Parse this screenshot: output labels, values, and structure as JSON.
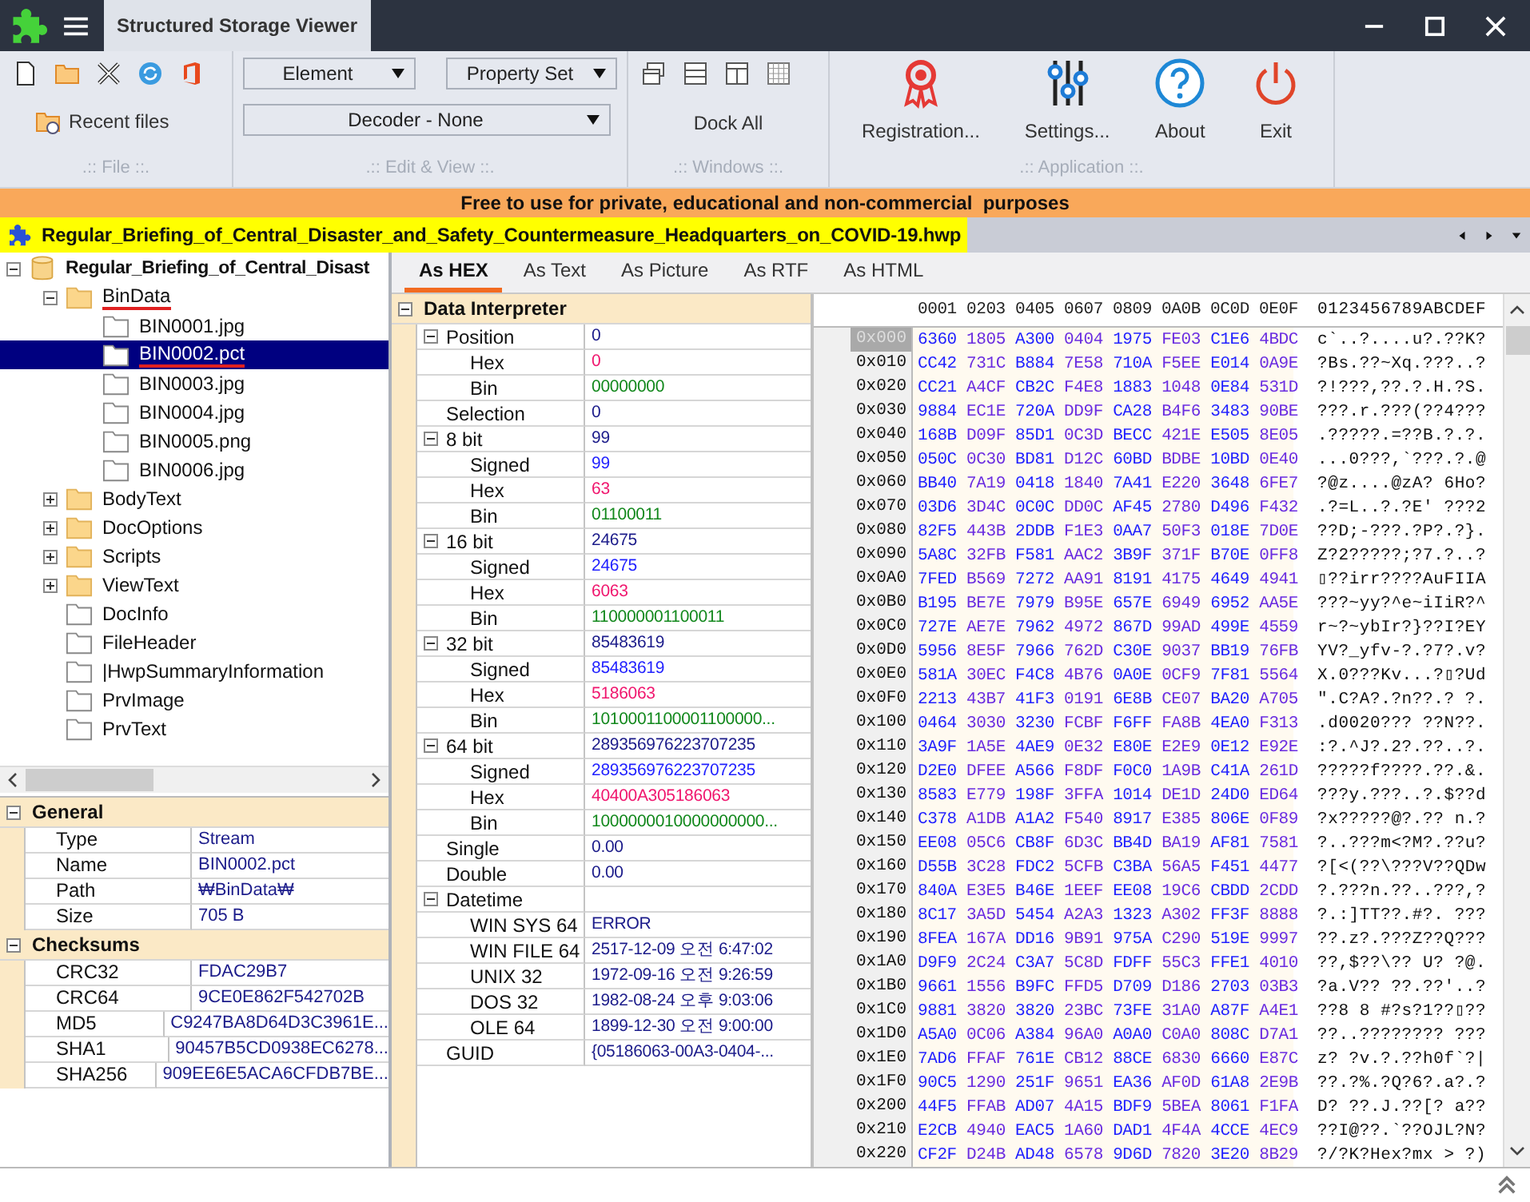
{
  "window": {
    "title": "Structured Storage Viewer"
  },
  "ribbon": {
    "file": {
      "recent": "Recent files",
      "label": ".:: File ::."
    },
    "edit": {
      "dropdowns": [
        "Element",
        "Property Set"
      ],
      "decoder": "Decoder - None",
      "label": ".:: Edit & View ::."
    },
    "windows": {
      "dock": "Dock All",
      "label": ".:: Windows ::."
    },
    "application": {
      "buttons": [
        {
          "kind": "registration",
          "label": "Registration..."
        },
        {
          "kind": "settings",
          "label": "Settings..."
        },
        {
          "kind": "about",
          "label": "About"
        },
        {
          "kind": "exit",
          "label": "Exit"
        }
      ],
      "label": ".:: Application ::."
    }
  },
  "banner": "Free to use for private, educational and non-commercial  purposes",
  "document_tab": {
    "title": "Regular_Briefing_of_Central_Disaster_and_Safety_Countermeasure_Headquarters_on_COVID-19.hwp"
  },
  "tree": {
    "items": [
      {
        "label": "Regular_Briefing_of_Central_Disast",
        "kind": "storage",
        "expanded": true,
        "selected": false,
        "children": [
          {
            "label": "BinData",
            "kind": "folder",
            "expanded": true,
            "selected": false,
            "underlined": true,
            "children": [
              {
                "label": "BIN0001.jpg",
                "kind": "file",
                "selected": false
              },
              {
                "label": "BIN0002.pct",
                "kind": "file",
                "selected": true,
                "underlined": true
              },
              {
                "label": "BIN0003.jpg",
                "kind": "file",
                "selected": false
              },
              {
                "label": "BIN0004.jpg",
                "kind": "file",
                "selected": false
              },
              {
                "label": "BIN0005.png",
                "kind": "file",
                "selected": false
              },
              {
                "label": "BIN0006.jpg",
                "kind": "file",
                "selected": false
              }
            ]
          },
          {
            "label": "BodyText",
            "kind": "folder",
            "expanded": false,
            "selected": false
          },
          {
            "label": "DocOptions",
            "kind": "folder",
            "expanded": false,
            "selected": false
          },
          {
            "label": "Scripts",
            "kind": "folder",
            "expanded": false,
            "selected": false
          },
          {
            "label": "ViewText",
            "kind": "folder",
            "expanded": false,
            "selected": false
          },
          {
            "label": "DocInfo",
            "kind": "file",
            "selected": false
          },
          {
            "label": "FileHeader",
            "kind": "file",
            "selected": false
          },
          {
            "label": "|HwpSummaryInformation",
            "kind": "file",
            "selected": false
          },
          {
            "label": "PrvImage",
            "kind": "file",
            "selected": false
          },
          {
            "label": "PrvText",
            "kind": "file",
            "selected": false
          }
        ]
      }
    ]
  },
  "properties": [
    {
      "title": "General",
      "expanded": true,
      "rows": [
        {
          "name": "Type",
          "value": "Stream"
        },
        {
          "name": "Name",
          "value": "BIN0002.pct"
        },
        {
          "name": "Path",
          "value": "₩BinData₩"
        },
        {
          "name": "Size",
          "value": "705 B"
        }
      ]
    },
    {
      "title": "Checksums",
      "expanded": true,
      "rows": [
        {
          "name": "CRC32",
          "value": "FDAC29B7"
        },
        {
          "name": "CRC64",
          "value": "9CE0E862F542702B"
        },
        {
          "name": "MD5",
          "value": "C9247BA8D64D3C3961E..."
        },
        {
          "name": "SHA1",
          "value": "90457B5CD0938EC6278..."
        },
        {
          "name": "SHA256",
          "value": "909EE6E5ACA6CFDB7BE..."
        }
      ]
    }
  ],
  "view_tabs": [
    {
      "label": "As HEX",
      "selected": true
    },
    {
      "label": "As Text",
      "selected": false
    },
    {
      "label": "As Picture",
      "selected": false
    },
    {
      "label": "As RTF",
      "selected": false
    },
    {
      "label": "As HTML",
      "selected": false
    }
  ],
  "interpreter": {
    "title": "Data Interpreter",
    "expanded": true,
    "rows": [
      {
        "name": "Position",
        "value": "0",
        "kind": "number",
        "expanded": true,
        "children": [
          {
            "name": "Hex",
            "value": "0",
            "kind": "hex"
          },
          {
            "name": "Bin",
            "value": "00000000",
            "kind": "bin"
          }
        ]
      },
      {
        "name": "Selection",
        "value": "0",
        "kind": "number"
      },
      {
        "name": "8 bit",
        "value": "99",
        "kind": "number",
        "expanded": true,
        "children": [
          {
            "name": "Signed",
            "value": "99",
            "kind": "signed"
          },
          {
            "name": "Hex",
            "value": "63",
            "kind": "hex"
          },
          {
            "name": "Bin",
            "value": "01100011",
            "kind": "bin"
          }
        ]
      },
      {
        "name": "16 bit",
        "value": "24675",
        "kind": "number",
        "expanded": true,
        "children": [
          {
            "name": "Signed",
            "value": "24675",
            "kind": "signed"
          },
          {
            "name": "Hex",
            "value": "6063",
            "kind": "hex"
          },
          {
            "name": "Bin",
            "value": "110000001100011",
            "kind": "bin"
          }
        ]
      },
      {
        "name": "32 bit",
        "value": "85483619",
        "kind": "number",
        "expanded": true,
        "children": [
          {
            "name": "Signed",
            "value": "85483619",
            "kind": "signed"
          },
          {
            "name": "Hex",
            "value": "5186063",
            "kind": "hex"
          },
          {
            "name": "Bin",
            "value": "1010001100001100000...",
            "kind": "bin"
          }
        ]
      },
      {
        "name": "64 bit",
        "value": "289356976223707235",
        "kind": "number",
        "expanded": true,
        "children": [
          {
            "name": "Signed",
            "value": "289356976223707235",
            "kind": "signed"
          },
          {
            "name": "Hex",
            "value": "40400A305186063",
            "kind": "hex"
          },
          {
            "name": "Bin",
            "value": "1000000010000000000...",
            "kind": "bin"
          }
        ]
      },
      {
        "name": "Single",
        "value": "0.00",
        "kind": "number"
      },
      {
        "name": "Double",
        "value": "0.00",
        "kind": "number"
      },
      {
        "name": "Datetime",
        "expanded": true,
        "children": [
          {
            "name": "WIN SYS 64",
            "value": "ERROR",
            "kind": "number"
          },
          {
            "name": "WIN FILE 64",
            "value": "2517-12-09 오전 6:47:02",
            "kind": "number"
          },
          {
            "name": "UNIX 32",
            "value": "1972-09-16 오전 9:26:59",
            "kind": "number"
          },
          {
            "name": "DOS 32",
            "value": "1982-08-24 오후 9:03:06",
            "kind": "number"
          },
          {
            "name": "OLE 64",
            "value": "1899-12-30 오전 9:00:00",
            "kind": "number"
          }
        ]
      },
      {
        "name": "GUID",
        "value": "{05186063-00A3-0404-...",
        "kind": "number"
      }
    ]
  },
  "hex": {
    "header": "0001 0203 0405 0607 0809 0A0B 0C0D 0E0F",
    "ascii_header": "0123456789ABCDEF",
    "rows": [
      {
        "offset": "0x000",
        "hex": "6360 1805 A300 0404 1975 FE03 C1E6 4BDC",
        "ascii": "c`..?....u?.??K?",
        "selected": true
      },
      {
        "offset": "0x010",
        "hex": "CC42 731C B884 7E58 710A F5EE E014 0A9E",
        "ascii": "?Bs.??~Xq.???..?",
        "selected": false
      },
      {
        "offset": "0x020",
        "hex": "CC21 A4CF CB2C F4E8 1883 1048 0E84 531D",
        "ascii": "?!???,??.?.H.?S.",
        "selected": false
      },
      {
        "offset": "0x030",
        "hex": "9884 EC1E 720A DD9F CA28 B4F6 3483 90BE",
        "ascii": "???.r.???(??4???",
        "selected": false
      },
      {
        "offset": "0x040",
        "hex": "168B D09F 85D1 0C3D BECC 421E E505 8E05",
        "ascii": ".?????.=??B.?.?.",
        "selected": false
      },
      {
        "offset": "0x050",
        "hex": "050C 0C30 BD81 D12C 60BD BDBE 10BD 0E40",
        "ascii": "...0???,`???.?.@",
        "selected": false
      },
      {
        "offset": "0x060",
        "hex": "BB40 7A19 0418 1840 7A41 E220 3648 6FE7",
        "ascii": "?@z....@zA? 6Ho?",
        "selected": false
      },
      {
        "offset": "0x070",
        "hex": "03D6 3D4C 0C0C DD0C AF45 2780 D496 F432",
        "ascii": ".?=L..?.?E' ???2",
        "selected": false
      },
      {
        "offset": "0x080",
        "hex": "82F5 443B 2DDB F1E3 0AA7 50F3 018E 7D0E",
        "ascii": "??D;-???.?P?.?}.",
        "selected": false
      },
      {
        "offset": "0x090",
        "hex": "5A8C 32FB F581 AAC2 3B9F 371F B70E 0FF8",
        "ascii": "Z?2?????;?7.?..?",
        "selected": false
      },
      {
        "offset": "0x0A0",
        "hex": "7FED B569 7272 AA91 8191 4175 4649 4941",
        "ascii": "▯??irr????AuFIIA",
        "selected": false
      },
      {
        "offset": "0x0B0",
        "hex": "B195 BE7E 7979 B95E 657E 6949 6952 AA5E",
        "ascii": "???~yy?^e~iIiR?^",
        "selected": false
      },
      {
        "offset": "0x0C0",
        "hex": "727E AE7E 7962 4972 867D 99AD 499E 4559",
        "ascii": "r~?~ybIr?}??I?EY",
        "selected": false
      },
      {
        "offset": "0x0D0",
        "hex": "5956 8E5F 7966 762D C30E 9037 BB19 76FB",
        "ascii": "YV?_yfv-?.?7?.v?",
        "selected": false
      },
      {
        "offset": "0x0E0",
        "hex": "581A 30EC F4C8 4B76 0A0E 0CF9 7F81 5564",
        "ascii": "X.0???Kv...?▯?Ud",
        "selected": false
      },
      {
        "offset": "0x0F0",
        "hex": "2213 43B7 41F3 0191 6E8B CE07 BA20 A705",
        "ascii": "\".C?A?.?n??.? ?.",
        "selected": false
      },
      {
        "offset": "0x100",
        "hex": "0464 3030 3230 FCBF F6FF FA8B 4EA0 F313",
        "ascii": ".d0020??? ??N??.",
        "selected": false
      },
      {
        "offset": "0x110",
        "hex": "3A9F 1A5E 4AE9 0E32 E80E E2E9 0E12 E92E",
        "ascii": ":?.^J?.2?.??..?.",
        "selected": false
      },
      {
        "offset": "0x120",
        "hex": "D2E0 DFEE A566 F8DF F0C0 1A9B C41A 261D",
        "ascii": "?????f????.??.&.",
        "selected": false
      },
      {
        "offset": "0x130",
        "hex": "8583 E779 198F 3FFA 1014 DE1D 24D0 ED64",
        "ascii": "???y.???..?.$??d",
        "selected": false
      },
      {
        "offset": "0x140",
        "hex": "C378 A1DB A1A2 F540 8917 E385 806E 0F89",
        "ascii": "?x?????@?.?? n.?",
        "selected": false
      },
      {
        "offset": "0x150",
        "hex": "EE08 05C6 CB8F 6D3C BB4D BA19 AF81 7581",
        "ascii": "?..???m<?M?.??u?",
        "selected": false
      },
      {
        "offset": "0x160",
        "hex": "D55B 3C28 FDC2 5CFB C3BA 56A5 F451 4477",
        "ascii": "?[<(??\\???V??QDw",
        "selected": false
      },
      {
        "offset": "0x170",
        "hex": "840A E3E5 B46E 1EEF EE08 19C6 CBDD 2CDD",
        "ascii": "?.???n.??..???,?",
        "selected": false
      },
      {
        "offset": "0x180",
        "hex": "8C17 3A5D 5454 A2A3 1323 A302 FF3F 8888",
        "ascii": "?.:]TT??.#?. ???",
        "selected": false
      },
      {
        "offset": "0x190",
        "hex": "8FEA 167A DD16 9B91 975A C290 519E 9997",
        "ascii": "??.z?.???Z??Q???",
        "selected": false
      },
      {
        "offset": "0x1A0",
        "hex": "D9F9 2C24 C3A7 5C8D FDFF 55C3 FFE1 4010",
        "ascii": "??,$??\\?? U? ?@.",
        "selected": false
      },
      {
        "offset": "0x1B0",
        "hex": "9661 1556 B9FC FFD5 D709 D186 2703 03B3",
        "ascii": "?a.V?? ??.??'..?",
        "selected": false
      },
      {
        "offset": "0x1C0",
        "hex": "9881 3820 3820 23BC 73FE 31A0 A87F A4E1",
        "ascii": "??8 8 #?s?1??▯??",
        "selected": false
      },
      {
        "offset": "0x1D0",
        "hex": "A5A0 0C06 A384 96A0 A0A0 C0A0 808C D7A1",
        "ascii": "??..???????? ???",
        "selected": false
      },
      {
        "offset": "0x1E0",
        "hex": "7AD6 FFAF 761E CB12 88CE 6830 6660 E87C",
        "ascii": "z? ?v.?.??h0f`?|",
        "selected": false
      },
      {
        "offset": "0x1F0",
        "hex": "90C5 1290 251F 9651 EA36 AF0D 61A8 2E9B",
        "ascii": "??.?%.?Q?6?.a?.?",
        "selected": false
      },
      {
        "offset": "0x200",
        "hex": "44F5 FFAB AD07 4A15 BDF9 5BEA 8061 F1FA",
        "ascii": "D? ??.J.??[? a??",
        "selected": false
      },
      {
        "offset": "0x210",
        "hex": "E2CB 4940 EAC5 1A60 DAD1 4F4A 4CCE 4EC9",
        "ascii": "??I@??.`??OJL?N?",
        "selected": false
      },
      {
        "offset": "0x220",
        "hex": "CF2F D24B AD48 6578 9D6D 7820 3E20 8B29",
        "ascii": "?/?K?Hex?mx > ?)",
        "selected": false
      }
    ]
  }
}
